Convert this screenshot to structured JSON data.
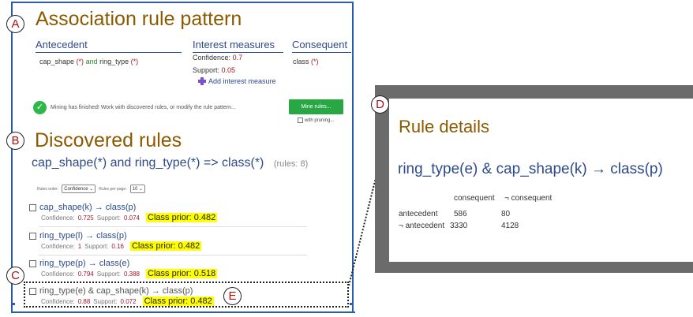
{
  "markers": {
    "a": "A",
    "b": "B",
    "c": "C",
    "d": "D",
    "e": "E"
  },
  "pattern": {
    "title": "Association rule pattern",
    "antecedent_header": "Antecedent",
    "interest_header": "Interest measures",
    "consequent_header": "Consequent",
    "antecedent_attr1": "cap_shape",
    "antecedent_attr2": "ring_type",
    "wildcard": "(*)",
    "and": "and",
    "confidence_label": "Confidence:",
    "confidence_value": "0.7",
    "support_label": "Support:",
    "support_value": "0.05",
    "add_measure": "Add interest measure",
    "consequent_attr": "class",
    "status": "Mining has finished! Work with discovered rules, or modify the rule pattern...",
    "mine_button": "Mine rules...",
    "pruning": "with pruning..."
  },
  "discovered": {
    "title": "Discovered rules",
    "summary": "cap_shape(*) and ring_type(*) => class(*)",
    "count": "(rules: 8)",
    "order_label": "Rules order:",
    "order_value": "Confidence",
    "perpage_label": "Rules per page:",
    "perpage_value": "10",
    "rules": [
      {
        "text": "cap_shape(k) → class(p)",
        "conf_label": "Confidence:",
        "conf": "0.725",
        "sup_label": "Support:",
        "sup": "0.074",
        "prior": "Class prior: 0.482"
      },
      {
        "text": "ring_type(l) → class(p)",
        "conf_label": "Confidence:",
        "conf": "1",
        "sup_label": "Support:",
        "sup": "0.16",
        "prior": "Class prior: 0.482"
      },
      {
        "text": "ring_type(p) → class(e)",
        "conf_label": "Confidence:",
        "conf": "0.794",
        "sup_label": "Support:",
        "sup": "0.388",
        "prior": "Class prior: 0.518"
      },
      {
        "text": "ring_type(e) & cap_shape(k) → class(p)",
        "conf_label": "Confidence:",
        "conf": "0.88",
        "sup_label": "Support:",
        "sup": "0.072",
        "prior": "Class prior: 0.482"
      }
    ]
  },
  "details": {
    "title": "Rule details",
    "rule": "ring_type(e) & cap_shape(k) → class(p)",
    "col1": "consequent",
    "col2": "¬ consequent",
    "row1": "antecedent",
    "row2": "¬ antecedent",
    "a_c": "586",
    "a_nc": "80",
    "na_c": "3330",
    "na_nc": "4128"
  },
  "colors": {
    "title_brown": "#8b5a00",
    "link_blue": "#2d4a8a",
    "accent_green": "#28a745",
    "highlight_yellow": "#ffff00",
    "marker_red": "#b01010"
  }
}
